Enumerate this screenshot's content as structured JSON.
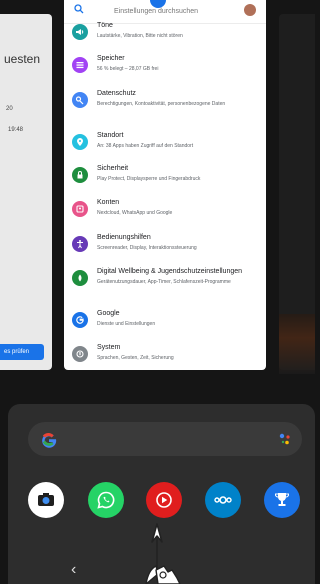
{
  "left_card": {
    "title_fragment": "uesten",
    "line2": "20",
    "line3": "19:48",
    "button": "es prüfen"
  },
  "settings": {
    "search_placeholder": "Einstellungen durchsuchen",
    "items": [
      {
        "title": "Töne",
        "subtitle": "Lautstärke, Vibration, Bitte nicht stören",
        "icon": "sound-icon",
        "color": "#1aa0a0"
      },
      {
        "title": "Speicher",
        "subtitle": "56 % belegt – 28,07 GB frei",
        "icon": "storage-icon",
        "color": "#a142f4"
      },
      {
        "title": "Datenschutz",
        "subtitle": "Berechtigungen, Kontoaktivität, personenbezogene Daten",
        "icon": "privacy-icon",
        "color": "#4285f4"
      },
      {
        "title": "Standort",
        "subtitle": "An: 38 Apps haben Zugriff auf den Standort",
        "icon": "location-icon",
        "color": "#24c1e0"
      },
      {
        "title": "Sicherheit",
        "subtitle": "Play Protect, Displaysperre und Fingerabdruck",
        "icon": "lock-icon",
        "color": "#1e8e3e"
      },
      {
        "title": "Konten",
        "subtitle": "Nextcloud, WhatsApp und Google",
        "icon": "accounts-icon",
        "color": "#e8548a"
      },
      {
        "title": "Bedienungshilfen",
        "subtitle": "Screenreader, Display, Interaktionssteuerung",
        "icon": "accessibility-icon",
        "color": "#673ab7"
      },
      {
        "title": "Digital Wellbeing & Jugendschutzeinstellungen",
        "subtitle": "Geräte­nutzungsdauer, App-Timer, Schlafenszeit-Programme",
        "icon": "wellbeing-icon",
        "color": "#1e8e3e"
      },
      {
        "title": "Google",
        "subtitle": "Dienste und Einstellungen",
        "icon": "google-icon",
        "color": "#1a73e8"
      },
      {
        "title": "System",
        "subtitle": "Sprachen, Gesten, Zeit, Sicherung",
        "icon": "system-icon",
        "color": "#80868b"
      }
    ]
  },
  "dock": {
    "apps": [
      {
        "name": "Kamera",
        "icon": "camera-icon",
        "color": "#ffffff"
      },
      {
        "name": "WhatsApp",
        "icon": "whatsapp-icon",
        "color": "#25d366"
      },
      {
        "name": "YouTube",
        "icon": "youtube-icon",
        "color": "#e01e1e"
      },
      {
        "name": "Nextcloud",
        "icon": "nextcloud-icon",
        "color": "#0082c9"
      },
      {
        "name": "Trophy",
        "icon": "trophy-icon",
        "color": "#1a73e8"
      }
    ]
  },
  "nav": {
    "back_glyph": "‹"
  }
}
